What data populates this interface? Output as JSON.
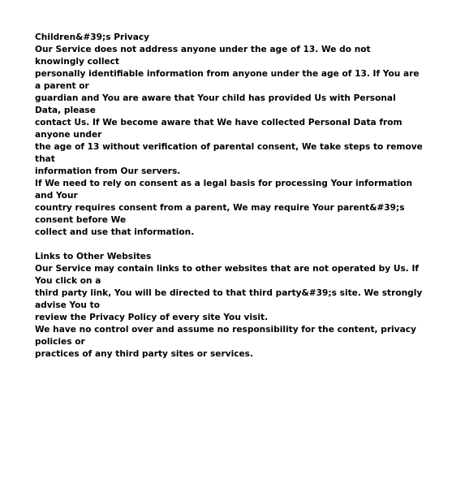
{
  "sections": [
    {
      "lines": [
        "Children&#39;s Privacy",
        "Our Service does not address anyone under the age of 13. We do not knowingly collect",
        "personally identifiable information from anyone under the age of 13. If You are a parent or",
        "guardian and You are aware that Your child has provided Us with Personal Data, please",
        "contact Us. If We become aware that We have collected Personal Data from anyone under",
        "the age of 13 without verification of parental consent, We take steps to remove that",
        "information from Our servers.",
        "If We need to rely on consent as a legal basis for processing Your information and Your",
        "country requires consent from a parent, We may require Your parent&#39;s consent before We",
        "collect and use that information."
      ]
    },
    {
      "lines": [
        "Links to Other Websites",
        "Our Service may contain links to other websites that are not operated by Us. If You click on a",
        "third party link, You will be directed to that third party&#39;s site. We strongly advise You to",
        "review the Privacy Policy of every site You visit.",
        "We have no control over and assume no responsibility for the content, privacy policies or",
        "practices of any third party sites or services."
      ]
    }
  ]
}
